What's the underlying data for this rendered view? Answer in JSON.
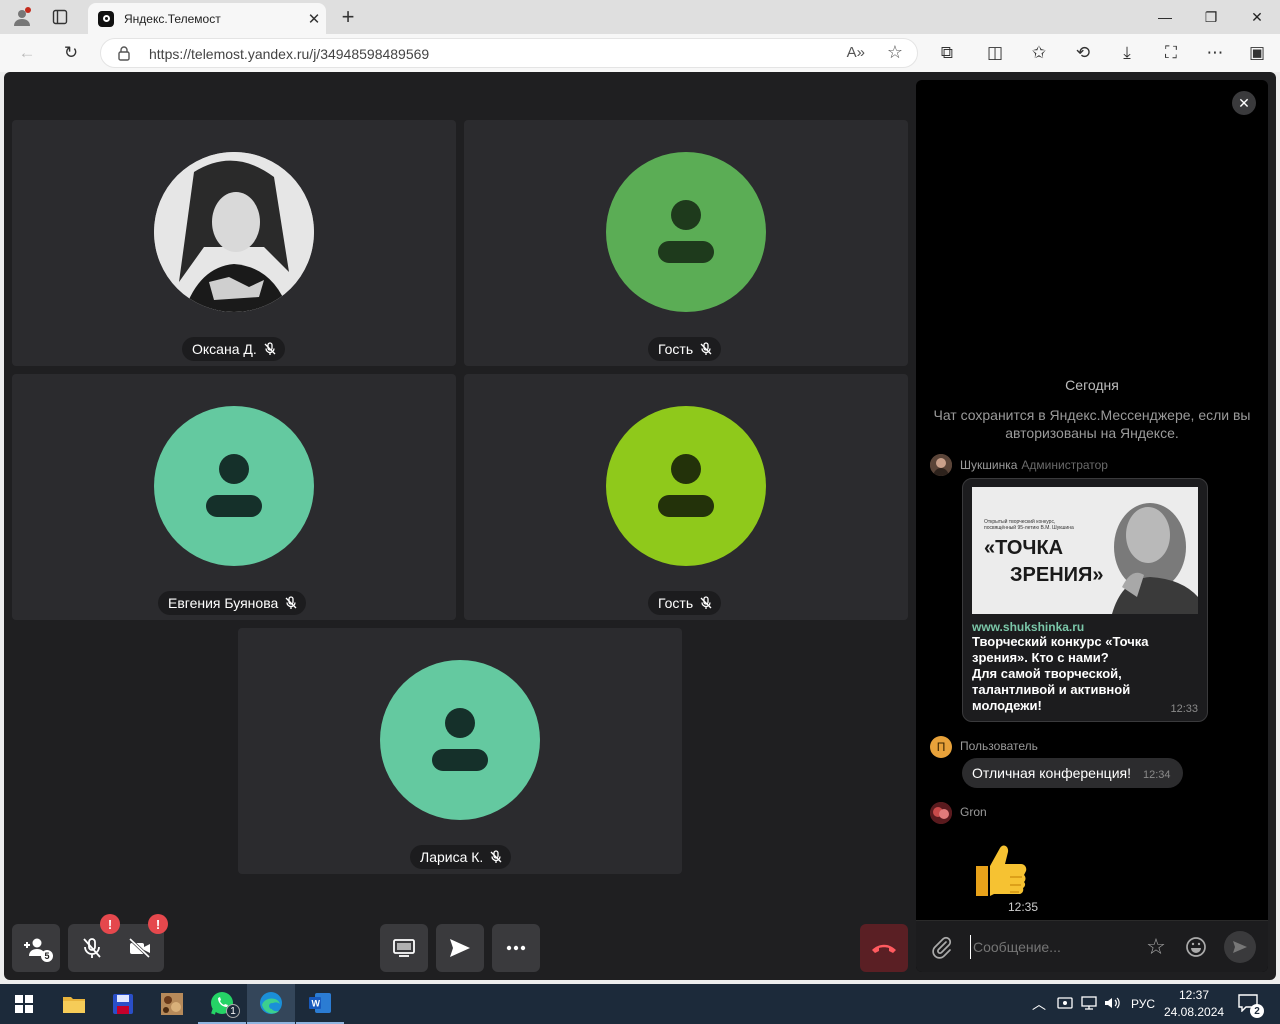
{
  "browser": {
    "tab_title": "Яндекс.Телемост",
    "url": "https://telemost.yandex.ru/j/34948598489569"
  },
  "participants": [
    {
      "name": "Оксана Д.",
      "avatar": "photo",
      "color": "#d0d0d0"
    },
    {
      "name": "Гость",
      "avatar": "default",
      "color": "#5bad55"
    },
    {
      "name": "Евгения Буянова",
      "avatar": "default",
      "color": "#64c9a0"
    },
    {
      "name": "Гость",
      "avatar": "default",
      "color": "#8fc91b"
    },
    {
      "name": "Лариса К.",
      "avatar": "default",
      "color": "#64c9a0"
    }
  ],
  "controls": {
    "participants_count": "5",
    "alert_mark": "!"
  },
  "chat": {
    "date_label": "Сегодня",
    "notice": "Чат сохранится в Яндекс.Мессенджере, если вы авторизованы на Яндексе.",
    "messages": [
      {
        "sender": "Шукшинка",
        "role": "Администратор",
        "link_preview": {
          "image_small_text": "Открытый творческий конкурс, посвящённый 95-летию В.М. Шукшина",
          "image_title_1": "«ТОЧКА",
          "image_title_2": "ЗРЕНИЯ»",
          "site": "www.shukshinka.ru",
          "title": "Творческий конкурс «Точка зрения». Кто с нами?",
          "description": "Для самой творческой, талантливой и активной молодежи!"
        },
        "time": "12:33"
      },
      {
        "sender": "Пользователь",
        "avatar_letter": "П",
        "text": "Отличная конференция!",
        "time": "12:34"
      },
      {
        "sender": "Gron",
        "sticker": "thumbs-up",
        "time": "12:35"
      }
    ],
    "input_placeholder": "Сообщение..."
  },
  "taskbar": {
    "lang": "РУС",
    "time": "12:37",
    "date": "24.08.2024",
    "notifications": "2",
    "whatsapp_badge": "1"
  }
}
